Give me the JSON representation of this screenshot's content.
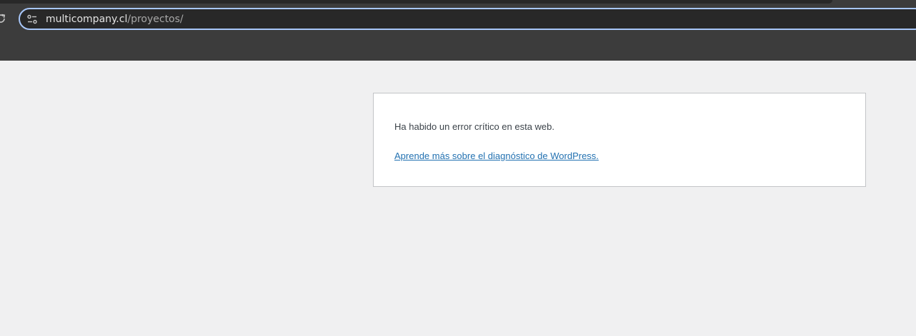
{
  "browser": {
    "icons": [
      "reload-icon",
      "site-info-icon"
    ],
    "address_bar": {
      "domain": "multicompany.cl",
      "path": "/proyectos/"
    },
    "colors": {
      "chrome_background": "#3c3c3c",
      "omnibox_background": "#282828",
      "omnibox_focus_border": "#a8c7fa"
    }
  },
  "page": {
    "error_message": "Ha habido un error crítico en esta web.",
    "help_link": "Aprende más sobre el diagnóstico de WordPress.",
    "colors": {
      "page_background": "#f0f0f1",
      "box_background": "#ffffff",
      "text": "#3c434a",
      "link": "#2271b1"
    }
  }
}
